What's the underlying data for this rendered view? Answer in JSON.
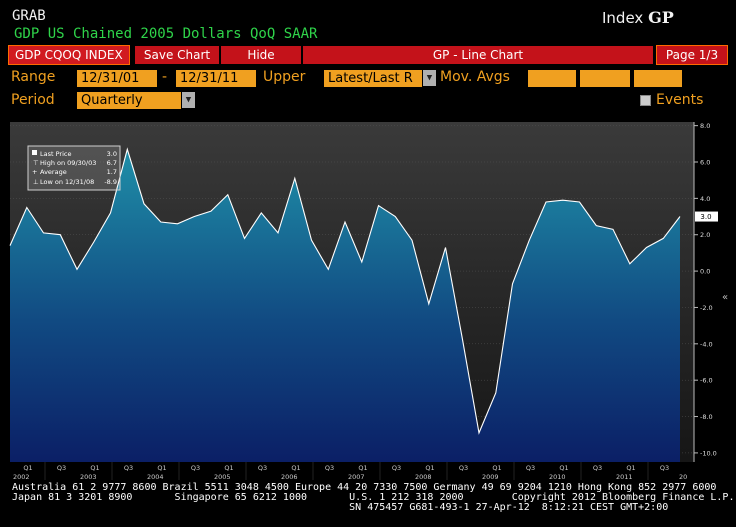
{
  "header": {
    "code": "GRAB",
    "index_label": "Index",
    "index_code": "GP",
    "subtitle": "GDP US Chained 2005 Dollars QoQ SAAR"
  },
  "toolbar": {
    "ticker": "GDP CQOQ INDEX",
    "save_label": "Save Chart",
    "hide_label": "Hide",
    "title": "GP - Line Chart",
    "page": "Page 1/3"
  },
  "controls": {
    "range_label": "Range",
    "start_date": "12/31/01",
    "dash": "-",
    "end_date": "12/31/11",
    "upper_label": "Upper",
    "upper_value": "Latest/Last R",
    "mov_avgs_label": "Mov. Avgs",
    "period_label": "Period",
    "period_value": "Quarterly",
    "events_label": "Events"
  },
  "legend": {
    "last_price_label": "Last Price",
    "last_price_value": "3.0",
    "high_label": "High on 09/30/03",
    "high_value": "6.7",
    "average_label": "Average",
    "average_value": "1.7",
    "low_label": "Low on 12/31/08",
    "low_value": "-8.9"
  },
  "footer": {
    "line1": "Australia 61 2 9777 8600 Brazil 5511 3048 4500 Europe 44 20 7330 7500 Germany 49 69 9204 1210 Hong Kong 852 2977 6000",
    "line2": "Japan 81 3 3201 8900       Singapore 65 6212 1000       U.S. 1 212 318 2000        Copyright 2012 Bloomberg Finance L.P.",
    "line3": "                                                        SN 475457 G681-493-1 27-Apr-12  8:12:21 CEST GMT+2:00"
  },
  "colors": {
    "background": "#000000",
    "title_green": "#2fd44a",
    "amber": "#f0a020",
    "toolbar_red": "#c4121a",
    "fill_top": "#1f8fa8",
    "fill_bottom": "#0b1f66",
    "line": "#ffffff"
  },
  "chart_data": {
    "type": "area",
    "y_ticks": [
      8.0,
      6.0,
      4.0,
      2.0,
      0.0,
      -2.0,
      -4.0,
      -6.0,
      -8.0,
      -10.0
    ],
    "ylim": [
      -10.5,
      8.2
    ],
    "last_value_tag": "3.0",
    "quarter_labels": [
      "Q1",
      "Q3",
      "Q1",
      "Q3",
      "Q1",
      "Q3",
      "Q1",
      "Q3",
      "Q1",
      "Q3",
      "Q1",
      "Q3",
      "Q1",
      "Q3",
      "Q1",
      "Q3",
      "Q1",
      "Q3",
      "Q1",
      "Q3"
    ],
    "year_labels": [
      "2002",
      "2003",
      "2004",
      "2005",
      "2006",
      "2007",
      "2008",
      "2009",
      "2010",
      "2011",
      "20"
    ],
    "series": [
      {
        "x": [
          "2001-12-31",
          "2002-03-31",
          "2002-06-30",
          "2002-09-30",
          "2002-12-31",
          "2003-03-31",
          "2003-06-30",
          "2003-09-30",
          "2003-12-31",
          "2004-03-31",
          "2004-06-30",
          "2004-09-30",
          "2004-12-31",
          "2005-03-31",
          "2005-06-30",
          "2005-09-30",
          "2005-12-31",
          "2006-03-31",
          "2006-06-30",
          "2006-09-30",
          "2006-12-31",
          "2007-03-31",
          "2007-06-30",
          "2007-09-30",
          "2007-12-31",
          "2008-03-31",
          "2008-06-30",
          "2008-09-30",
          "2008-12-31",
          "2009-03-31",
          "2009-06-30",
          "2009-09-30",
          "2009-12-31",
          "2010-03-31",
          "2010-06-30",
          "2010-09-30",
          "2010-12-31",
          "2011-03-31",
          "2011-06-30",
          "2011-09-30",
          "2011-12-31"
        ],
        "values": [
          1.4,
          3.5,
          2.1,
          2.0,
          0.1,
          1.6,
          3.2,
          6.7,
          3.7,
          2.7,
          2.6,
          3.0,
          3.3,
          4.2,
          1.8,
          3.2,
          2.1,
          5.1,
          1.7,
          0.1,
          2.7,
          0.5,
          3.6,
          3.0,
          1.7,
          -1.8,
          1.3,
          -3.7,
          -8.9,
          -6.7,
          -0.7,
          1.7,
          3.8,
          3.9,
          3.8,
          2.5,
          2.3,
          0.4,
          1.3,
          1.8,
          3.0
        ]
      }
    ]
  }
}
